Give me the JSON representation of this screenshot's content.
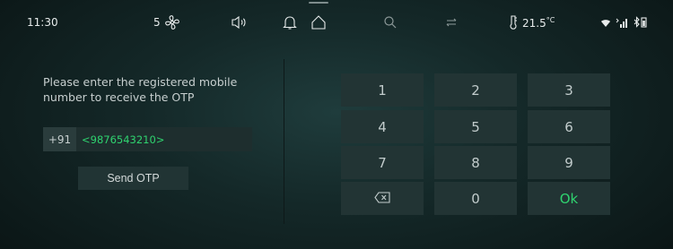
{
  "status_bar": {
    "time": "11:30",
    "fan_level": "5",
    "temperature": "21.5",
    "temperature_unit": "°C",
    "icons": [
      "fan-icon",
      "volume-icon",
      "bell-icon",
      "home-icon",
      "search-icon",
      "repeat-icon",
      "thermometer-icon",
      "wifi-icon",
      "signal-icon",
      "bluetooth-icon"
    ]
  },
  "otp_form": {
    "prompt": "Please enter the registered mobile number to receive the OTP",
    "country_code": "+91",
    "phone_value": "<9876543210>",
    "send_label": "Send OTP"
  },
  "keypad": {
    "keys": [
      "1",
      "2",
      "3",
      "4",
      "5",
      "6",
      "7",
      "8",
      "9",
      "⌫",
      "0",
      "Ok"
    ],
    "ok_color": "#2fd36f"
  },
  "colors": {
    "accent_green": "#2fd36f",
    "background": "#142828",
    "key_bg": "#223434"
  }
}
